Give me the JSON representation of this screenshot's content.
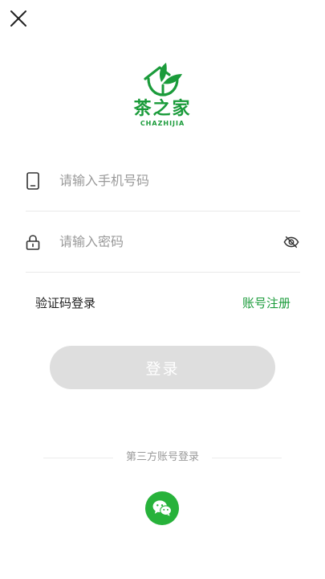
{
  "header": {
    "close_icon": "close-icon"
  },
  "logo": {
    "title": "茶之家",
    "subtitle": "CHAZHIJIA",
    "brand_color": "#1a9b3a"
  },
  "form": {
    "phone": {
      "icon": "phone-icon",
      "placeholder": "请输入手机号码",
      "value": ""
    },
    "password": {
      "icon": "lock-icon",
      "placeholder": "请输入密码",
      "value": "",
      "toggle_icon": "eye-off-icon"
    }
  },
  "links": {
    "code_login": "验证码登录",
    "register": "账号注册"
  },
  "login_button": {
    "label": "登录",
    "enabled": false
  },
  "third_party": {
    "title": "第三方账号登录",
    "wechat_icon": "wechat-icon",
    "wechat_color": "#27b23a"
  }
}
